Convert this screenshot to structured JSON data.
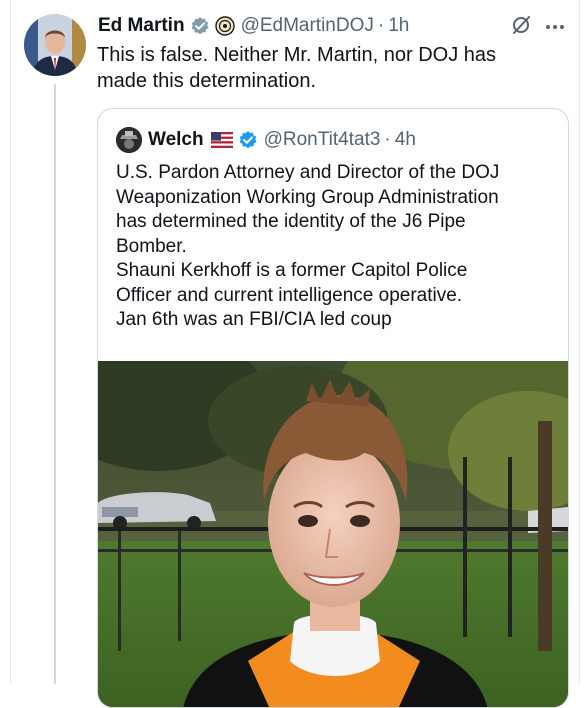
{
  "tweet": {
    "author_name": "Ed Martin",
    "author_handle": "@EdMartinDOJ",
    "separator": "·",
    "time": "1h",
    "text": "This is false. Neither Mr. Martin, nor DOJ has made this determination."
  },
  "quoted_tweet": {
    "author_name": "Welch",
    "author_handle": "@RonTit4tat3",
    "separator": "·",
    "time": "4h",
    "lines": [
      "U.S. Pardon Attorney and Director of the DOJ",
      "Weaponization Working Group Administration",
      "has determined the identity of the J6 Pipe",
      "Bomber.",
      "Shauni Kerkhoff is a former Capitol Police",
      "Officer and current intelligence operative.",
      "Jan 6th was an FBI/CIA led coup"
    ]
  },
  "icons": {
    "verified": "verified-badge-icon",
    "affiliate": "affiliate-badge-icon",
    "flag": "us-flag-icon",
    "grok": "grok-icon",
    "more": "more-icon"
  },
  "colors": {
    "text": "#0f1419",
    "secondary": "#536471",
    "verified_blue": "#1d9bf0",
    "border": "#cfd9de"
  }
}
